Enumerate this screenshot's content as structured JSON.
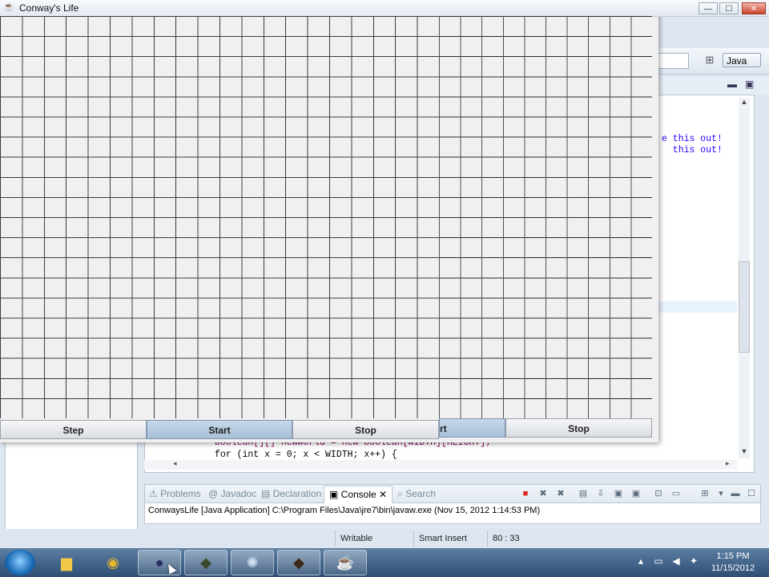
{
  "life_window": {
    "title": "Conway's Life",
    "controls": {
      "minimize": "—",
      "maximize": "☐",
      "close": "✕"
    },
    "buttons": {
      "step": "Step",
      "start": "Start",
      "stop": "Stop",
      "start_partial": "rt",
      "stop_right": "Stop"
    }
  },
  "eclipse": {
    "perspective": {
      "label": "Java"
    },
    "editor_code": {
      "line1": "e this out!",
      "line2": "  this out!",
      "line3": "boolean[][] newWorld = new boolean[WIDTH][HEIGHT];",
      "line4": "for (int x = 0; x < WIDTH; x++) {"
    },
    "console_tabs": [
      "Problems",
      "Javadoc",
      "Declaration",
      "Console",
      "Search"
    ],
    "console_line": "ConwaysLife [Java Application] C:\\Program Files\\Java\\jre7\\bin\\javaw.exe (Nov 15, 2012 1:14:53 PM)",
    "status": {
      "writable": "Writable",
      "insert_mode": "Smart Insert",
      "position": "80 : 33"
    }
  },
  "taskbar": {
    "time": "1:15 PM",
    "date": "11/15/2012",
    "apps": [
      "explorer",
      "chrome",
      "eclipse",
      "terminal",
      "loading",
      "tool",
      "java"
    ]
  },
  "colors": {
    "taskbar": "#2e4e73",
    "start_button": "#a8bfd6",
    "grid_line": "#3c3c3c"
  }
}
